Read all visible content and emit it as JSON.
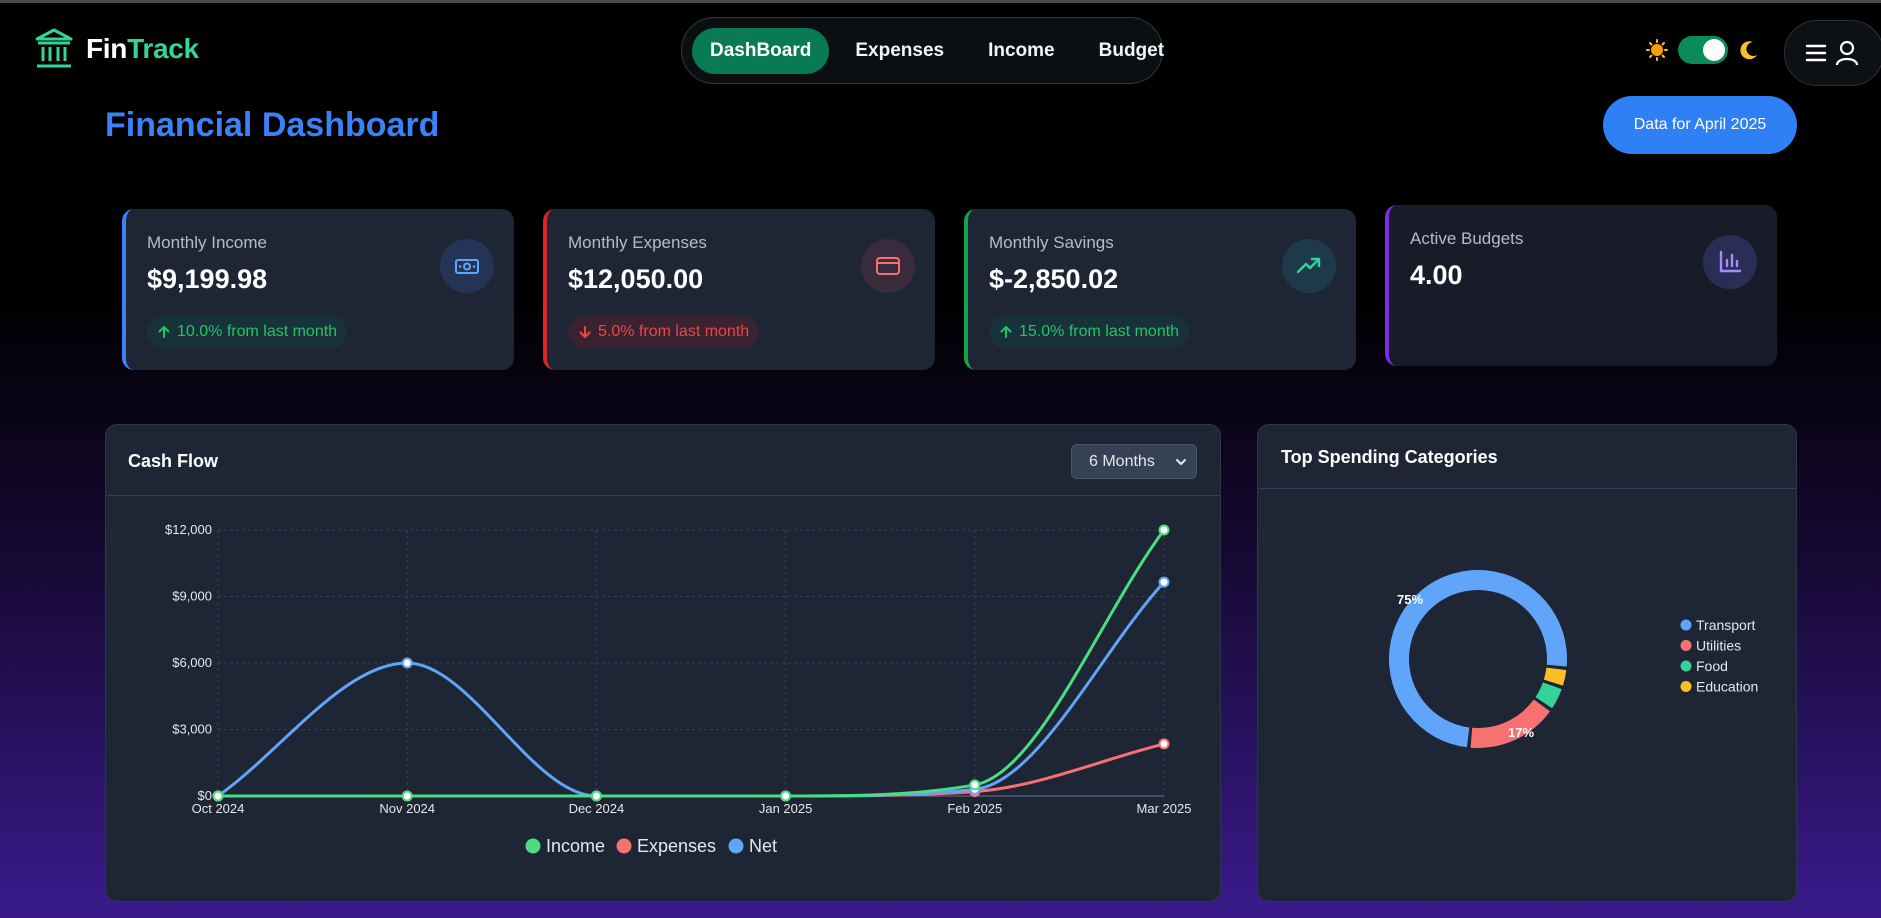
{
  "brand": {
    "name_part1": "Fin",
    "name_part2": "Track"
  },
  "nav": {
    "items": [
      "DashBoard",
      "Expenses",
      "Income",
      "Budget"
    ],
    "active": "DashBoard"
  },
  "theme": {
    "dark_mode": true
  },
  "page": {
    "title": "Financial Dashboard",
    "date_button": "Data for April 2025"
  },
  "cards": [
    {
      "label": "Monthly Income",
      "value": "$9,199.98",
      "trend": "10.0% from last month",
      "direction": "up",
      "color": "#3b82f6",
      "icon": "money-icon"
    },
    {
      "label": "Monthly Expenses",
      "value": "$12,050.00",
      "trend": "5.0% from last month",
      "direction": "down",
      "color": "#dc2626",
      "icon": "credit-card-icon"
    },
    {
      "label": "Monthly Savings",
      "value": "$-2,850.02",
      "trend": "15.0% from last month",
      "direction": "up",
      "color": "#16a34a",
      "icon": "trending-up-icon"
    },
    {
      "label": "Active Budgets",
      "value": "4.00",
      "color": "#7c2de0",
      "icon": "bar-chart-icon"
    }
  ],
  "cashflow": {
    "title": "Cash Flow",
    "period": "6 Months"
  },
  "spending": {
    "title": "Top Spending Categories"
  },
  "chart_data": [
    {
      "type": "line",
      "x": [
        "Oct 2024",
        "Nov 2024",
        "Dec 2024",
        "Jan 2025",
        "Feb 2025",
        "Mar 2025"
      ],
      "yticks": [
        "$0",
        "$3,000",
        "$6,000",
        "$9,000",
        "$12,000"
      ],
      "ylim": [
        0,
        12000
      ],
      "grid": true,
      "legend": "bottom",
      "series": [
        {
          "name": "Income",
          "values": [
            0,
            0,
            0,
            0,
            500,
            12000
          ],
          "color": "#4ade80"
        },
        {
          "name": "Expenses",
          "values": [
            0,
            0,
            0,
            0,
            200,
            2350
          ],
          "color": "#f87171"
        },
        {
          "name": "Net",
          "values": [
            0,
            6000,
            0,
            0,
            300,
            9650
          ],
          "color": "#60a5fa"
        }
      ]
    },
    {
      "type": "pie",
      "legend": "right",
      "categories": [
        "Transport",
        "Utilities",
        "Food",
        "Education"
      ],
      "values": [
        75,
        17,
        4.5,
        3.5
      ],
      "colors": [
        "#60a5fa",
        "#f87171",
        "#34d399",
        "#fbbf24"
      ],
      "data_labels": [
        "75%",
        "17%"
      ]
    }
  ]
}
